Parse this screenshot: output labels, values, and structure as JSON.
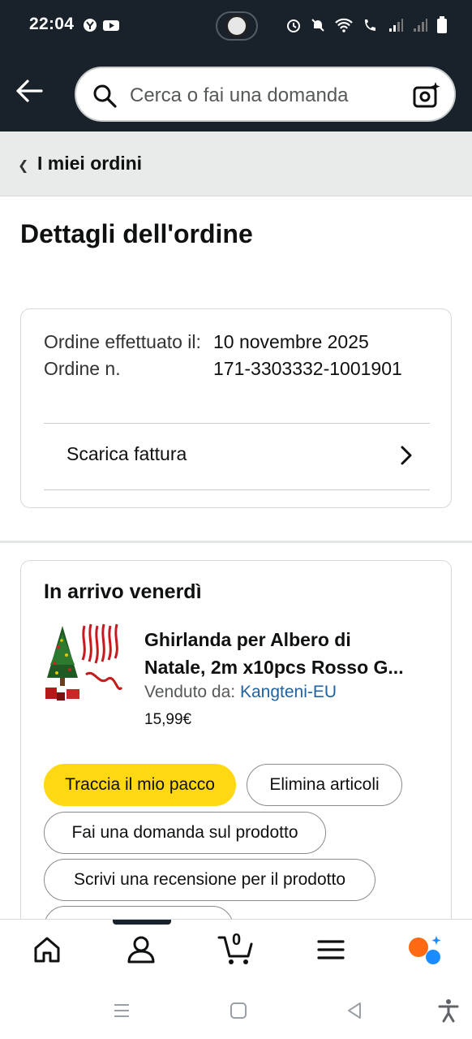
{
  "status_bar": {
    "time": "22:04"
  },
  "header": {
    "search_placeholder": "Cerca o fai una domanda"
  },
  "breadcrumb": {
    "label": "I miei ordini"
  },
  "page": {
    "title": "Dettagli dell'ordine"
  },
  "order_info": {
    "placed_label": "Ordine effettuato il:",
    "placed_value": "10 novembre 2025",
    "number_label": "Ordine n.",
    "number_value": "171-3303332-1001901",
    "invoice_label": "Scarica fattura"
  },
  "shipment": {
    "heading": "In arrivo venerdì",
    "product_title_line1": "Ghirlanda per Albero di",
    "product_title_line2": "Natale, 2m x10pcs Rosso G...",
    "seller_label": "Venduto da:",
    "seller_name": "Kangteni-EU",
    "price": "15,99€",
    "buttons": {
      "track": "Traccia il mio pacco",
      "delete": "Elimina articoli",
      "ask": "Fai una domanda sul prodotto",
      "review": "Scrivi una recensione per il prodotto"
    }
  },
  "bottom_nav": {
    "cart_count": "0"
  },
  "colors": {
    "header_bg": "#19212b",
    "primary_button": "#ffd814",
    "link": "#2162a1"
  }
}
